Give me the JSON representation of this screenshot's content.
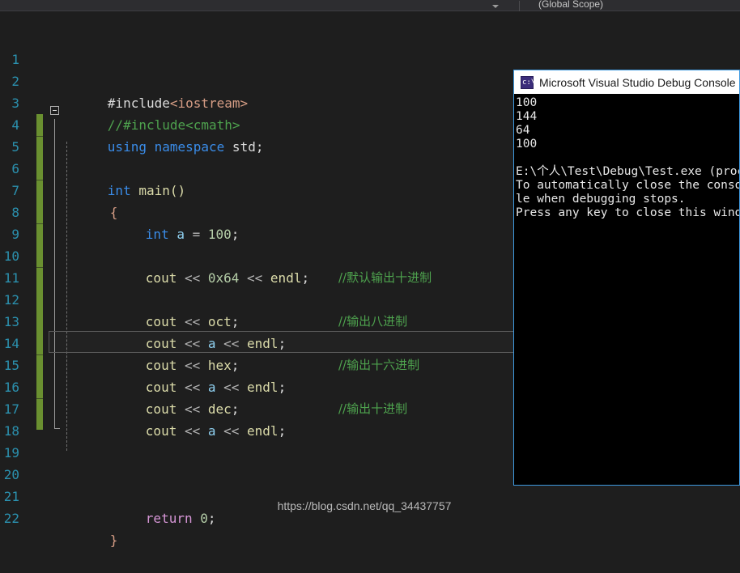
{
  "window": {
    "navbar": {
      "scope": "(Global Scope)",
      "dropdown_icon": "chevron-down-icon"
    }
  },
  "editor": {
    "theme": "dark",
    "background": "#1e1e1e",
    "current_line": 15,
    "colors": {
      "line_number": "#2b91af",
      "keyword": "#3a8ce8",
      "comment": "#4ea24e",
      "string": "#d69d85",
      "number": "#b5cea8",
      "function": "#dcdcaa",
      "variable": "#8fd0f0",
      "control": "#d696d6",
      "plain": "#dcdcdc",
      "change_bar": "#6a9030"
    },
    "lines": [
      {
        "n": "1",
        "code": "#include<iostream>"
      },
      {
        "n": "2",
        "code": "//#include<cmath>"
      },
      {
        "n": "3",
        "code": "using namespace std;"
      },
      {
        "n": "4",
        "code": ""
      },
      {
        "n": "5",
        "code": "int main()"
      },
      {
        "n": "6",
        "code": "{"
      },
      {
        "n": "7",
        "code": "    int a = 100;"
      },
      {
        "n": "8",
        "code": ""
      },
      {
        "n": "9",
        "code": "    cout << 0x64 << endl;    //默认输出十进制"
      },
      {
        "n": "10",
        "code": ""
      },
      {
        "n": "11",
        "code": "    cout << oct;             //输出八进制"
      },
      {
        "n": "12",
        "code": "    cout << a << endl;"
      },
      {
        "n": "13",
        "code": "    cout << hex;             //输出十六进制"
      },
      {
        "n": "14",
        "code": "    cout << a << endl;"
      },
      {
        "n": "15",
        "code": "    cout << dec;             //输出十进制"
      },
      {
        "n": "16",
        "code": "    cout << a << endl;"
      },
      {
        "n": "17",
        "code": ""
      },
      {
        "n": "18",
        "code": ""
      },
      {
        "n": "19",
        "code": ""
      },
      {
        "n": "20",
        "code": "    return 0;"
      },
      {
        "n": "21",
        "code": "}"
      },
      {
        "n": "22",
        "code": ""
      }
    ],
    "tokens": {
      "l1_a": "#include",
      "l1_b": "<iostream>",
      "l2": "//#include<cmath>",
      "l3_a": "using namespace",
      "l3_b": " std;",
      "l5_a": "int",
      "l5_b": " main()",
      "l6": "{",
      "l7_a": "int",
      "l7_b": " a",
      "l7_c": " = ",
      "l7_d": "100",
      "l7_e": ";",
      "l9_a": "cout",
      "l9_b": " << ",
      "l9_c": "0x64",
      "l9_d": " << ",
      "l9_e": "endl",
      "l9_f": ";",
      "l9_g": "//默认输出十进制",
      "l11_a": "cout",
      "l11_b": " << ",
      "l11_c": "oct",
      "l11_d": ";",
      "l11_e": "//输出八进制",
      "l12_a": "cout",
      "l12_b": " << ",
      "l12_c": "a",
      "l12_d": " << ",
      "l12_e": "endl",
      "l12_f": ";",
      "l13_a": "cout",
      "l13_b": " << ",
      "l13_c": "hex",
      "l13_d": ";",
      "l13_e": "//输出十六进制",
      "l14_a": "cout",
      "l14_b": " << ",
      "l14_c": "a",
      "l14_d": " << ",
      "l14_e": "endl",
      "l14_f": ";",
      "l15_a": "cout",
      "l15_b": " << ",
      "l15_c": "dec",
      "l15_d": ";",
      "l15_e": "//输出十进制",
      "l16_a": "cout",
      "l16_b": " << ",
      "l16_c": "a",
      "l16_d": " << ",
      "l16_e": "endl",
      "l16_f": ";",
      "l20_a": "return",
      "l20_b": " 0",
      "l20_c": ";",
      "l21": "}"
    }
  },
  "console": {
    "title": "Microsoft Visual Studio Debug Console",
    "icon": "console-app-icon",
    "border_color": "#3f9ae0",
    "output": [
      "100",
      "144",
      "64",
      "100",
      "",
      "E:\\个人\\Test\\Debug\\Test.exe (proces",
      "To automatically close the console",
      "le when debugging stops.",
      "Press any key to close this window"
    ]
  },
  "watermark": {
    "text": "https://blog.csdn.net/qq_34437757"
  }
}
